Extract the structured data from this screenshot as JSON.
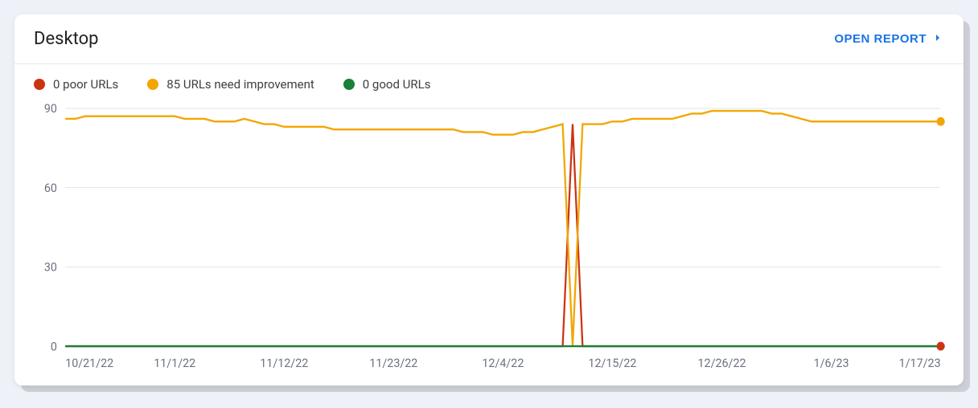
{
  "header": {
    "title": "Desktop",
    "open_report_label": "OPEN REPORT"
  },
  "legend": {
    "items": [
      {
        "key": "poor",
        "label": "0 poor URLs",
        "color": "#cc3311"
      },
      {
        "key": "ni",
        "label": "85 URLs need improvement",
        "color": "#f2a600"
      },
      {
        "key": "good",
        "label": "0 good URLs",
        "color": "#188038"
      }
    ]
  },
  "chart_data": {
    "type": "line",
    "xlabel": "",
    "ylabel": "",
    "ylim": [
      0,
      90
    ],
    "yticks": [
      0,
      30,
      60,
      90
    ],
    "x_tick_labels": [
      "10/21/22",
      "11/1/22",
      "11/12/22",
      "11/23/22",
      "12/4/22",
      "12/15/22",
      "12/26/22",
      "1/6/23",
      "1/17/23"
    ],
    "x": [
      "10/21/22",
      "10/22/22",
      "10/23/22",
      "10/24/22",
      "10/25/22",
      "10/26/22",
      "10/27/22",
      "10/28/22",
      "10/29/22",
      "10/30/22",
      "10/31/22",
      "11/01/22",
      "11/02/22",
      "11/03/22",
      "11/04/22",
      "11/05/22",
      "11/06/22",
      "11/07/22",
      "11/08/22",
      "11/09/22",
      "11/10/22",
      "11/11/22",
      "11/12/22",
      "11/13/22",
      "11/14/22",
      "11/15/22",
      "11/16/22",
      "11/17/22",
      "11/18/22",
      "11/19/22",
      "11/20/22",
      "11/21/22",
      "11/22/22",
      "11/23/22",
      "11/24/22",
      "11/25/22",
      "11/26/22",
      "11/27/22",
      "11/28/22",
      "11/29/22",
      "11/30/22",
      "12/01/22",
      "12/02/22",
      "12/03/22",
      "12/04/22",
      "12/05/22",
      "12/06/22",
      "12/07/22",
      "12/08/22",
      "12/09/22",
      "12/10/22",
      "12/11/22",
      "12/12/22",
      "12/13/22",
      "12/14/22",
      "12/15/22",
      "12/16/22",
      "12/17/22",
      "12/18/22",
      "12/19/22",
      "12/20/22",
      "12/21/22",
      "12/22/22",
      "12/23/22",
      "12/24/22",
      "12/25/22",
      "12/26/22",
      "12/27/22",
      "12/28/22",
      "12/29/22",
      "12/30/22",
      "12/31/22",
      "1/01/23",
      "1/02/23",
      "1/03/23",
      "1/04/23",
      "1/05/23",
      "1/06/23",
      "1/07/23",
      "1/08/23",
      "1/09/23",
      "1/10/23",
      "1/11/23",
      "1/12/23",
      "1/13/23",
      "1/14/23",
      "1/15/23",
      "1/16/23",
      "1/17/23"
    ],
    "series": [
      {
        "name": "poor",
        "color": "#cc3311",
        "values": [
          0,
          0,
          0,
          0,
          0,
          0,
          0,
          0,
          0,
          0,
          0,
          0,
          0,
          0,
          0,
          0,
          0,
          0,
          0,
          0,
          0,
          0,
          0,
          0,
          0,
          0,
          0,
          0,
          0,
          0,
          0,
          0,
          0,
          0,
          0,
          0,
          0,
          0,
          0,
          0,
          0,
          0,
          0,
          0,
          0,
          0,
          0,
          0,
          0,
          0,
          0,
          84,
          0,
          0,
          0,
          0,
          0,
          0,
          0,
          0,
          0,
          0,
          0,
          0,
          0,
          0,
          0,
          0,
          0,
          0,
          0,
          0,
          0,
          0,
          0,
          0,
          0,
          0,
          0,
          0,
          0,
          0,
          0,
          0,
          0,
          0,
          0,
          0,
          0
        ]
      },
      {
        "name": "ni",
        "color": "#f2a600",
        "values": [
          86,
          86,
          87,
          87,
          87,
          87,
          87,
          87,
          87,
          87,
          87,
          87,
          86,
          86,
          86,
          85,
          85,
          85,
          86,
          85,
          84,
          84,
          83,
          83,
          83,
          83,
          83,
          82,
          82,
          82,
          82,
          82,
          82,
          82,
          82,
          82,
          82,
          82,
          82,
          82,
          81,
          81,
          81,
          80,
          80,
          80,
          81,
          81,
          82,
          83,
          84,
          0,
          84,
          84,
          84,
          85,
          85,
          86,
          86,
          86,
          86,
          86,
          87,
          88,
          88,
          89,
          89,
          89,
          89,
          89,
          89,
          88,
          88,
          87,
          86,
          85,
          85,
          85,
          85,
          85,
          85,
          85,
          85,
          85,
          85,
          85,
          85,
          85,
          85
        ]
      },
      {
        "name": "good",
        "color": "#188038",
        "values": [
          0,
          0,
          0,
          0,
          0,
          0,
          0,
          0,
          0,
          0,
          0,
          0,
          0,
          0,
          0,
          0,
          0,
          0,
          0,
          0,
          0,
          0,
          0,
          0,
          0,
          0,
          0,
          0,
          0,
          0,
          0,
          0,
          0,
          0,
          0,
          0,
          0,
          0,
          0,
          0,
          0,
          0,
          0,
          0,
          0,
          0,
          0,
          0,
          0,
          0,
          0,
          0,
          0,
          0,
          0,
          0,
          0,
          0,
          0,
          0,
          0,
          0,
          0,
          0,
          0,
          0,
          0,
          0,
          0,
          0,
          0,
          0,
          0,
          0,
          0,
          0,
          0,
          0,
          0,
          0,
          0,
          0,
          0,
          0,
          0,
          0,
          0,
          0,
          0
        ]
      }
    ],
    "endpoints": [
      {
        "series": "ni",
        "value": 85
      },
      {
        "series": "poor",
        "value": 0
      }
    ]
  }
}
